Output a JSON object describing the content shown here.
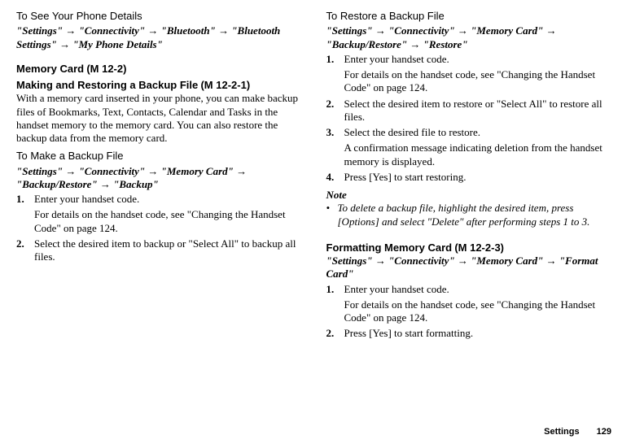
{
  "left": {
    "h1": "To See Your Phone Details",
    "path1_a": "\"Settings\"",
    "path1_b": "\"Connectivity\"",
    "path1_c": "\"Bluetooth\"",
    "path1_d": "\"Bluetooth Settings\"",
    "path1_e": "\"My Phone Details\"",
    "memcard_label": "Memory Card",
    "memcard_code": "(M 12-2)",
    "mkrestore_title": "Making and Restoring a Backup File",
    "mkrestore_code": "(M 12-2-1)",
    "mkrestore_body": "With a memory card inserted in your phone, you can make backup files of Bookmarks, Text, Contacts, Calendar and Tasks in the handset memory to the memory card. You can also restore the backup data from the memory card.",
    "h2": "To Make a Backup File",
    "path2_a": "\"Settings\"",
    "path2_b": "\"Connectivity\"",
    "path2_c": "\"Memory Card\"",
    "path2_d": "\"Backup/Restore\"",
    "path2_e": "\"Backup\"",
    "steps2": [
      {
        "n": "1.",
        "t": "Enter your handset code.",
        "sub": "For details on the handset code, see \"Changing the Handset Code\" on page 124."
      },
      {
        "n": "2.",
        "t": "Select the desired item to backup or \"Select All\" to backup all files."
      }
    ]
  },
  "right": {
    "h1": "To Restore a Backup File",
    "path1_a": "\"Settings\"",
    "path1_b": "\"Connectivity\"",
    "path1_c": "\"Memory Card\"",
    "path1_d": "\"Backup/Restore\"",
    "path1_e": "\"Restore\"",
    "steps1": [
      {
        "n": "1.",
        "t": "Enter your handset code.",
        "sub": "For details on the handset code, see \"Changing the Handset Code\" on page 124."
      },
      {
        "n": "2.",
        "t": "Select the desired item to restore or \"Select All\" to restore all files."
      },
      {
        "n": "3.",
        "t": "Select the desired file to restore.",
        "sub": "A confirmation message indicating deletion from the handset memory is displayed."
      },
      {
        "n": "4.",
        "t": "Press [Yes] to start restoring."
      }
    ],
    "note_label": "Note",
    "note_text": "To delete a backup file, highlight the desired item, press [Options] and select \"Delete\" after performing steps 1 to 3.",
    "format_title": "Formatting Memory Card",
    "format_code": "(M 12-2-3)",
    "path2_a": "\"Settings\"",
    "path2_b": "\"Connectivity\"",
    "path2_c": "\"Memory Card\"",
    "path2_d": "\"Format Card\"",
    "steps2": [
      {
        "n": "1.",
        "t": "Enter your handset code.",
        "sub": "For details on the handset code, see \"Changing the Handset Code\" on page 124."
      },
      {
        "n": "2.",
        "t": "Press [Yes] to start formatting."
      }
    ]
  },
  "footer": {
    "label": "Settings",
    "page": "129"
  },
  "arrow": "→"
}
